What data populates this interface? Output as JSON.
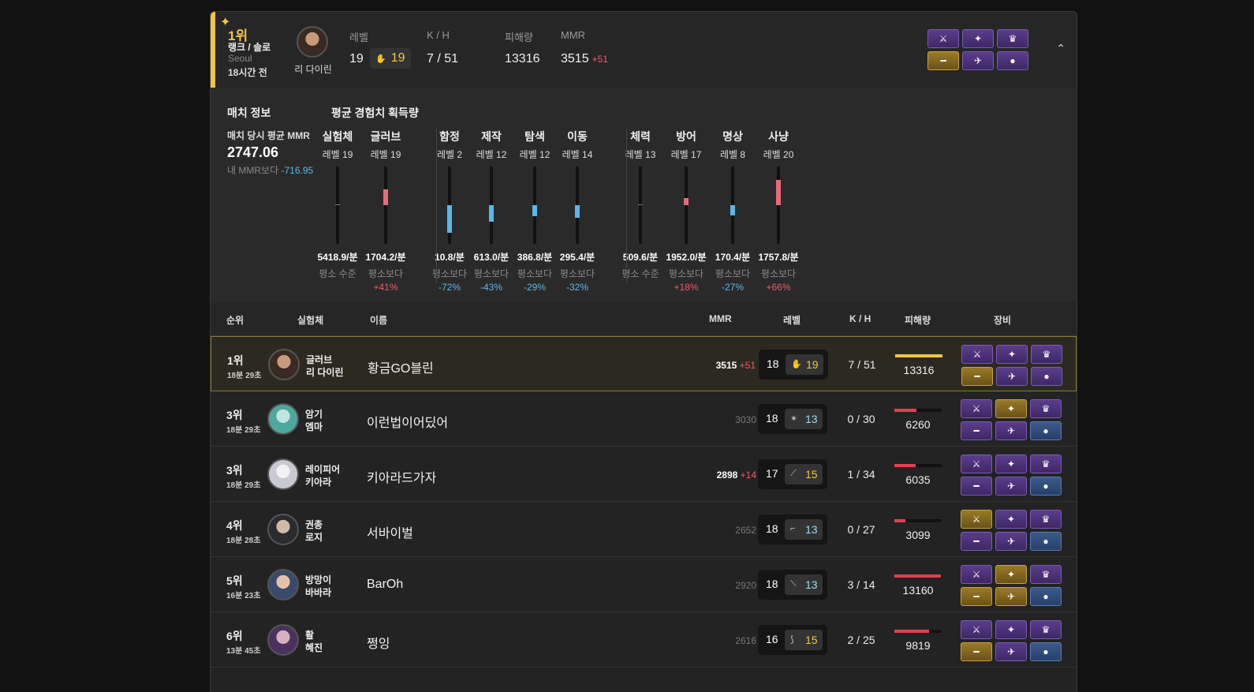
{
  "summary": {
    "rank": "1위",
    "mode": "랭크 / 솔로",
    "region": "Seoul",
    "time_ago": "18시간 전",
    "character": "리 다이린",
    "labels": {
      "level": "레벨",
      "kh": "K / H",
      "damage": "피해량",
      "mmr": "MMR"
    },
    "level": "19",
    "weapon_level": "19",
    "kh": "7 / 51",
    "damage": "13316",
    "mmr": "3515",
    "mmr_gain": "+51"
  },
  "match_info": {
    "title": "매치 정보",
    "avg_mmr_label": "매치 당시 평균 MMR",
    "avg_mmr": "2747.06",
    "vs_mine_label": "내 MMR보다",
    "vs_mine": "-716.95"
  },
  "xp": {
    "title": "평균 경험치 획득량",
    "stats": [
      {
        "name": "실험체",
        "level": "레벨 19",
        "rate": "5418.9/분",
        "cmp": "평소 수준",
        "pct": "",
        "trend": "none",
        "ratio": 0.0
      },
      {
        "name": "글러브",
        "level": "레벨 19",
        "rate": "1704.2/분",
        "cmp": "평소보다",
        "pct": "+41%",
        "trend": "pos",
        "ratio": 0.41
      },
      {
        "name": "함정",
        "level": "레벨 2",
        "rate": "10.8/분",
        "cmp": "평소보다",
        "pct": "-72%",
        "trend": "neg",
        "ratio": 0.72
      },
      {
        "name": "제작",
        "level": "레벨 12",
        "rate": "613.0/분",
        "cmp": "평소보다",
        "pct": "-43%",
        "trend": "neg",
        "ratio": 0.43
      },
      {
        "name": "탐색",
        "level": "레벨 12",
        "rate": "386.8/분",
        "cmp": "평소보다",
        "pct": "-29%",
        "trend": "neg",
        "ratio": 0.29
      },
      {
        "name": "이동",
        "level": "레벨 14",
        "rate": "295.4/분",
        "cmp": "평소보다",
        "pct": "-32%",
        "trend": "neg",
        "ratio": 0.32
      },
      {
        "name": "체력",
        "level": "레벨 13",
        "rate": "509.6/분",
        "cmp": "평소 수준",
        "pct": "",
        "trend": "none",
        "ratio": 0.0
      },
      {
        "name": "방어",
        "level": "레벨 17",
        "rate": "1952.0/분",
        "cmp": "평소보다",
        "pct": "+18%",
        "trend": "pos",
        "ratio": 0.18
      },
      {
        "name": "명상",
        "level": "레벨 8",
        "rate": "170.4/분",
        "cmp": "평소보다",
        "pct": "-27%",
        "trend": "neg",
        "ratio": 0.27
      },
      {
        "name": "사냥",
        "level": "레벨 20",
        "rate": "1757.8/분",
        "cmp": "평소보다",
        "pct": "+66%",
        "trend": "pos",
        "ratio": 0.66
      }
    ]
  },
  "table": {
    "headers": {
      "rank": "순위",
      "character": "실험체",
      "name": "이름",
      "mmr": "MMR",
      "level": "레벨",
      "kh": "K / H",
      "damage": "피해량",
      "gear": "장비"
    },
    "rows": [
      {
        "rank": "1위",
        "time": "18분 29초",
        "weapon": "글러브",
        "character": "리 다이린",
        "name": "황금GO블린",
        "mmr": "3515",
        "mmr_gain": "+51",
        "level": "18",
        "weapon_level": "19",
        "weapon_icon": "glove-icon",
        "weapon_color": "gold",
        "kh": "7 / 51",
        "damage": "13316",
        "damage_ratio": 1.0,
        "bar_color": "#f4c542",
        "mine": true
      },
      {
        "rank": "3위",
        "time": "18분 29초",
        "weapon": "암기",
        "character": "엠마",
        "name": "이런법이어딨어",
        "mmr": "3030",
        "mmr_gain": "",
        "level": "18",
        "weapon_level": "13",
        "weapon_icon": "shuriken-icon",
        "weapon_color": "cyan",
        "kh": "0 / 30",
        "damage": "6260",
        "damage_ratio": 0.47,
        "bar_color": "#e0414f",
        "mine": false
      },
      {
        "rank": "3위",
        "time": "18분 29초",
        "weapon": "레이피어",
        "character": "키아라",
        "name": "키아라드가자",
        "mmr": "2898",
        "mmr_gain": "+14",
        "level": "17",
        "weapon_level": "15",
        "weapon_icon": "rapier-icon",
        "weapon_color": "gold",
        "kh": "1 / 34",
        "damage": "6035",
        "damage_ratio": 0.45,
        "bar_color": "#e0414f",
        "mine": false
      },
      {
        "rank": "4위",
        "time": "18분 28초",
        "weapon": "권총",
        "character": "로지",
        "name": "서바이벌",
        "mmr": "2652",
        "mmr_gain": "",
        "level": "18",
        "weapon_level": "13",
        "weapon_icon": "pistol-icon",
        "weapon_color": "cyan",
        "kh": "0 / 27",
        "damage": "3099",
        "damage_ratio": 0.23,
        "bar_color": "#e0414f",
        "mine": false
      },
      {
        "rank": "5위",
        "time": "16분 23초",
        "weapon": "방망이",
        "character": "바바라",
        "name": "BarOh",
        "mmr": "2920",
        "mmr_gain": "",
        "level": "18",
        "weapon_level": "13",
        "weapon_icon": "bat-icon",
        "weapon_color": "cyan",
        "kh": "3 / 14",
        "damage": "13160",
        "damage_ratio": 0.99,
        "bar_color": "#e0414f",
        "mine": false
      },
      {
        "rank": "6위",
        "time": "13분 45초",
        "weapon": "활",
        "character": "혜진",
        "name": "쩡잉",
        "mmr": "2616",
        "mmr_gain": "",
        "level": "16",
        "weapon_level": "15",
        "weapon_icon": "bow-icon",
        "weapon_color": "gold",
        "kh": "2 / 25",
        "damage": "9819",
        "damage_ratio": 0.74,
        "bar_color": "#e0414f",
        "mine": false
      }
    ]
  },
  "colors": {
    "accent": "#f4c542",
    "positive": "#f05a6b",
    "negative": "#5ab8e8"
  }
}
